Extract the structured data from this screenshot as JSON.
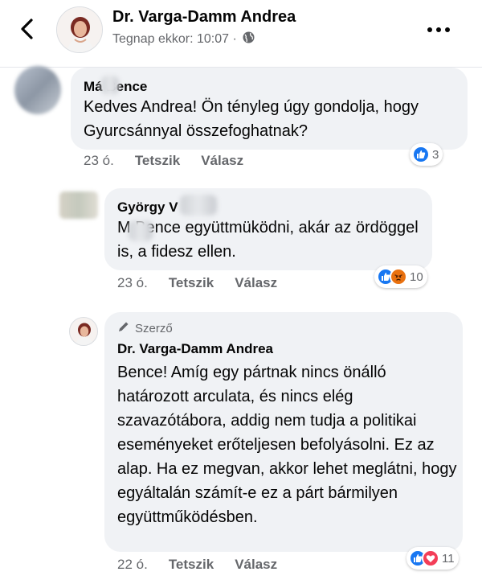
{
  "header": {
    "author_name": "Dr. Varga-Damm Andrea",
    "meta": "Tegnap ekkor: 10:07 ·",
    "privacy_icon": "globe-icon"
  },
  "comments": [
    {
      "author": "Má  Bence",
      "text": "Kedves Andrea! Ön tényleg úgy gondolja, hogy Gyurcsánnyal összefoghatnak?",
      "time": "23 ó.",
      "like_label": "Tetszik",
      "reply_label": "Válasz",
      "reactions": [
        "like"
      ],
      "reaction_count": "3"
    },
    {
      "author": "György V",
      "text": "M     Bence együttmüködni, akár az ördöggel is, a fidesz  ellen.",
      "time": "23 ó.",
      "like_label": "Tetszik",
      "reply_label": "Válasz",
      "reactions": [
        "like",
        "angry"
      ],
      "reaction_count": "10"
    },
    {
      "badge": "Szerző",
      "author": "Dr. Varga-Damm Andrea",
      "text": "Bence! Amíg egy pártnak nincs önálló határozott arculata, és nincs elég szavazótábora, addig nem tudja a politikai eseményeket erőteljesen befolyásolni. Ez az alap. Ha ez megvan, akkor lehet meglátni, hogy egyáltalán számít-e ez a párt bármilyen együttműködésben.",
      "time": "22 ó.",
      "like_label": "Tetszik",
      "reply_label": "Válasz",
      "reactions": [
        "like",
        "love"
      ],
      "reaction_count": "11"
    }
  ],
  "colors": {
    "like": "#1877f2",
    "love": "#f33e58",
    "angry": "#e9710f",
    "secondary_text": "#65676b",
    "bubble": "#f0f2f5"
  }
}
